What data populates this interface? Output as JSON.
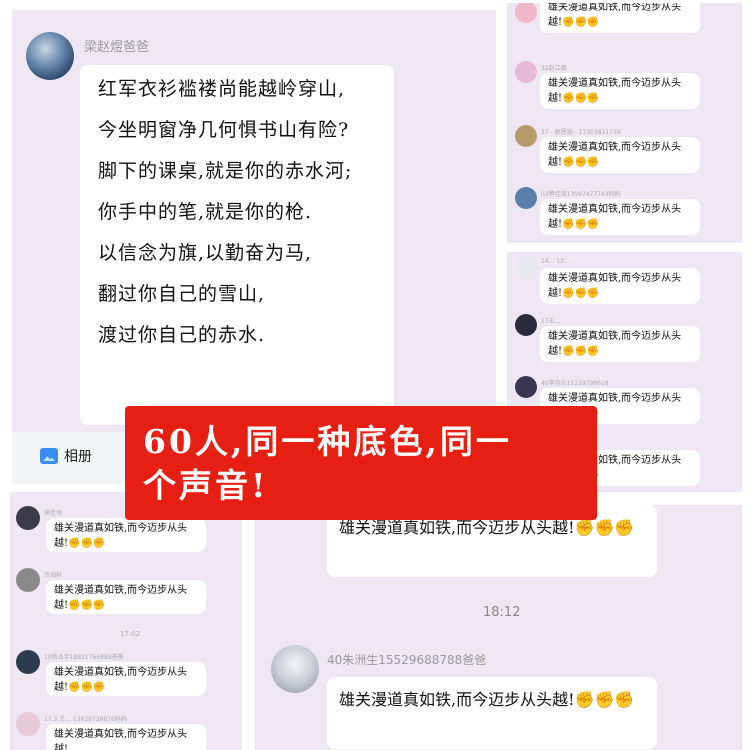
{
  "poem_panel": {
    "sender": "梁赵煜爸爸",
    "lines": [
      "红军衣衫褴褛尚能越岭穿山,",
      "今坐明窗净几何惧书山有险?",
      "脚下的课桌,就是你的赤水河;",
      "你手中的笔,就是你的枪.",
      "以信念为旗,以勤奋为马,",
      "翻过你自己的雪山,",
      "渡过你自己的赤水."
    ]
  },
  "message_text": "雄关漫道真如铁,而今迈步从头越!",
  "fist_emoji": "✊✊✊",
  "right_top": {
    "messages": [
      {
        "name": ""
      },
      {
        "name": "32赵江璐"
      },
      {
        "name": "27 - 郭恩涵 - 17303811734"
      },
      {
        "name": "02蒋佳琦13997477743妈妈"
      }
    ]
  },
  "right_mid": {
    "messages": [
      {
        "name": "14... 13..."
      },
      {
        "name": "17王..."
      },
      {
        "name": "40李亦乐15229798628"
      },
      {
        "name": ""
      }
    ]
  },
  "bottom_left": {
    "messages": [
      {
        "name": "高佳悦"
      },
      {
        "name": "许润轩"
      },
      {
        "name": "10杨泽宇18811766888爸爸"
      },
      {
        "name": "17.3 王... 13629726876妈妈"
      }
    ],
    "time": "17:02"
  },
  "bottom_right": {
    "time": "18:12",
    "sender2": "40朱洲生15529688788爸爸"
  },
  "toolbar": {
    "album_label": "相册"
  },
  "banner": {
    "line1": "60人,同一种底色,同一",
    "line2": "个声音!",
    "color": "#e61f12"
  }
}
